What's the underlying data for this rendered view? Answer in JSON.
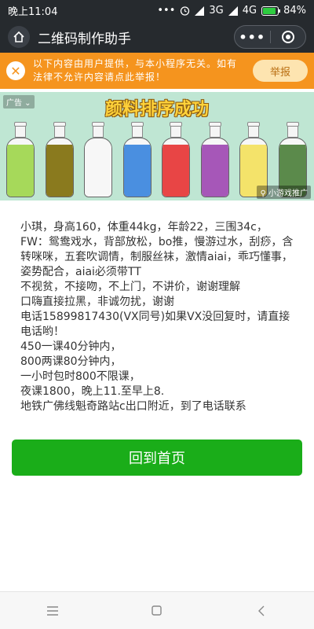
{
  "status": {
    "time": "晚上11:04",
    "dots": "•••",
    "network1": "3G",
    "network2": "4G",
    "battery": "84%"
  },
  "header": {
    "title": "二维码制作助手",
    "home_icon": "home-icon",
    "more_icon": "more-dots-icon",
    "close_icon": "capsule-close-icon"
  },
  "warning": {
    "text": "以下内容由用户提供，与本小程序无关。如有法律不允许内容请点此举报！",
    "report_label": "举报",
    "icon": "close-x-icon"
  },
  "ad": {
    "tag": "广告",
    "title": "颜料排序成功",
    "source": "小游戏推广",
    "bottle_colors": [
      "#a6d95a",
      "#8a7a1e",
      "#f7f7f7",
      "#4a8fe0",
      "#e84545",
      "#a657b8",
      "#f4e36a",
      "#5b8a4b"
    ]
  },
  "content": {
    "text": "小琪，身高160，体重44kg，年龄22，三围34c，FW：鸳鸯戏水，背部放松，bo推，慢游过水，刮痧，含转咪咪，五套吹调情，制服丝袜，激情aiai，乖巧懂事，姿势配合，aiai必须带TT\n不视贫，不接吻，不上门，不讲价，谢谢理解\n口嗨直接拉黑，非诚勿扰，谢谢\n电话15899817430(VX同号)如果VX没回复时，请直接电话哟！\n450一课40分钟内，\n800两课80分钟内，\n一小时包时800不限课，\n夜课1800，晚上11.至早上8.\n地铁广佛线魁奇路站c出口附近，到了电话联系"
  },
  "back_button": {
    "label": "回到首页"
  },
  "nav": {
    "menu": "☰",
    "home": "▢",
    "back": "‹"
  }
}
